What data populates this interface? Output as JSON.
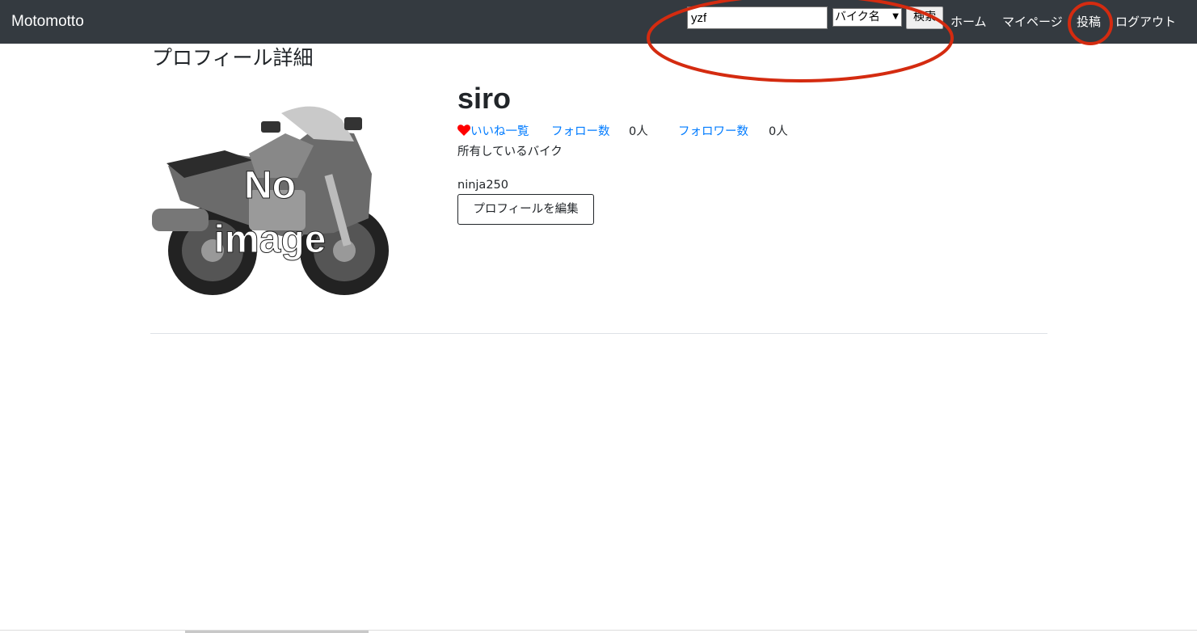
{
  "navbar": {
    "brand": "Motomotto",
    "search": {
      "value": "yzf",
      "select_value": "バイク名",
      "button_label": "検索"
    },
    "links": {
      "home": "ホーム",
      "mypage": "マイページ",
      "post": "投稿",
      "logout": "ログアウト"
    }
  },
  "page": {
    "title": "プロフィール詳細"
  },
  "profile": {
    "image_text_line1": "No",
    "image_text_line2": "image",
    "username": "siro",
    "likes_label": "いいね一覧",
    "follow_label": "フォロー数",
    "follow_count": "0人",
    "follower_label": "フォロワー数",
    "follower_count": "0人",
    "owned_bike_label": "所有しているバイク",
    "owned_bike": "ninja250",
    "edit_button": "プロフィールを編集"
  },
  "colors": {
    "navbar_bg": "#343a40",
    "link": "#007bff",
    "heart": "#ff0000",
    "annotation_circle": "#d42b10"
  }
}
